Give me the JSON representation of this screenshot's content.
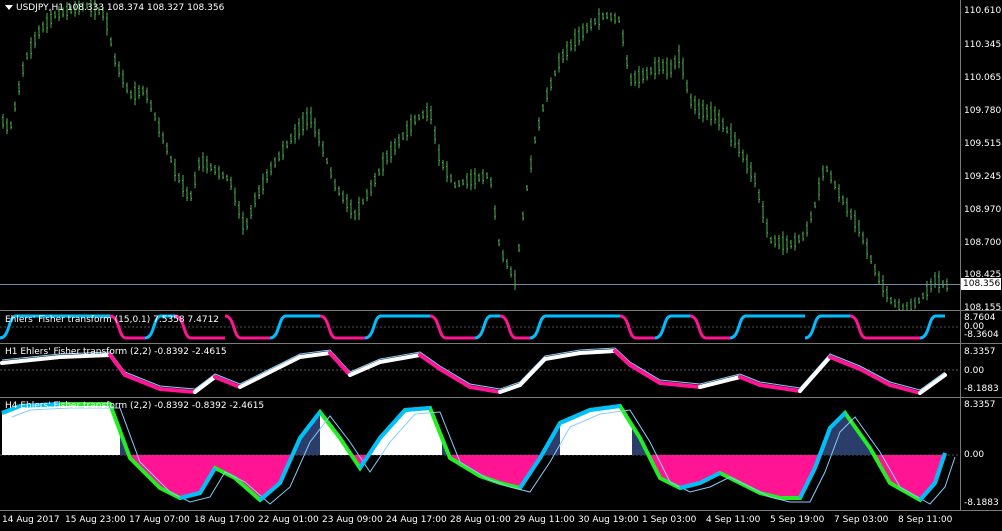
{
  "main": {
    "symbol_label": "USDJPY,H1",
    "ohlc": "108.333 108.374 108.327 108.356",
    "current_price": "108.356",
    "y_labels": [
      "110.610",
      "110.345",
      "110.065",
      "109.780",
      "109.515",
      "109.245",
      "108.970",
      "108.700",
      "108.425",
      "108.155"
    ],
    "bar_color": "#4caf50"
  },
  "panel1": {
    "title": "Ehlers' Fisher transform (15,0.1)",
    "values": "7.5358 7.4712",
    "y_labels": [
      "8.7604",
      "0.00",
      "-8.3604"
    ]
  },
  "panel2": {
    "title": "H1 Ehlers' Fisher transform (2,2)",
    "values": "-0.8392 -2.4615",
    "y_labels": [
      "8.3357",
      "0.00",
      "-8.1883"
    ]
  },
  "panel3": {
    "title": "H4 Ehlers' Fisher transform (2,2)",
    "values": "-0.8392 -0.8392 -2.4615",
    "y_labels": [
      "8.3357",
      "0.00",
      "-8.1883"
    ]
  },
  "colors": {
    "up": "#00bfff",
    "down": "#ff1493",
    "white": "#ffffff",
    "green": "#22ee22",
    "signal": "#87cefa"
  },
  "x_labels": [
    "14 Aug 2017",
    "15 Aug 23:00",
    "17 Aug 07:00",
    "18 Aug 17:00",
    "22 Aug 01:00",
    "23 Aug 09:00",
    "24 Aug 17:00",
    "28 Aug 01:00",
    "29 Aug 11:00",
    "30 Aug 19:00",
    "1 Sep 03:00",
    "4 Sep 11:00",
    "5 Sep 19:00",
    "7 Sep 03:00",
    "8 Sep 11:00"
  ]
}
